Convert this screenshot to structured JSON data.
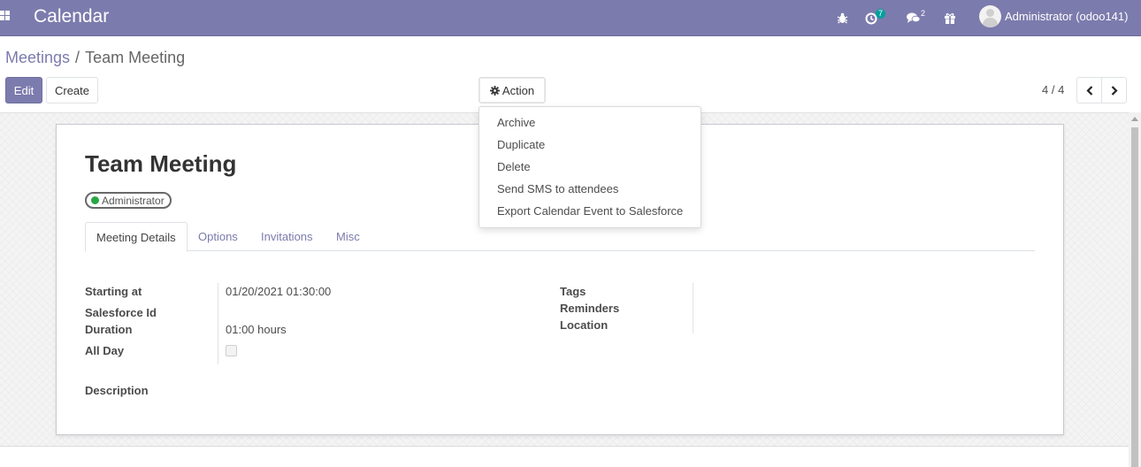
{
  "navbar": {
    "app_title": "Calendar",
    "activity_badge": "7",
    "messages_badge": "2",
    "user_name": "Administrator (odoo141)"
  },
  "breadcrumb": {
    "parent": "Meetings",
    "separator": "/",
    "current": "Team Meeting"
  },
  "toolbar": {
    "edit_label": "Edit",
    "create_label": "Create",
    "action_label": "Action"
  },
  "pager": {
    "value": "4 / 4"
  },
  "action_menu": {
    "items": [
      "Archive",
      "Duplicate",
      "Delete",
      "Send SMS to attendees",
      "Export Calendar Event to Salesforce"
    ]
  },
  "record": {
    "title": "Team Meeting",
    "tag": "Administrator",
    "tabs": [
      "Meeting Details",
      "Options",
      "Invitations",
      "Misc"
    ],
    "active_tab": "Meeting Details",
    "fields_left": {
      "starting_at_label": "Starting at",
      "starting_at_value": "01/20/2021 01:30:00",
      "salesforce_id_label": "Salesforce Id",
      "duration_label": "Duration",
      "duration_value": "01:00 hours",
      "all_day_label": "All Day",
      "all_day_checked": false
    },
    "fields_right": {
      "tags_label": "Tags",
      "reminders_label": "Reminders",
      "location_label": "Location"
    },
    "description_label": "Description"
  },
  "colors": {
    "brand": "#7c7bad",
    "tag_dot": "#28a745",
    "badge": "#00a09d"
  }
}
